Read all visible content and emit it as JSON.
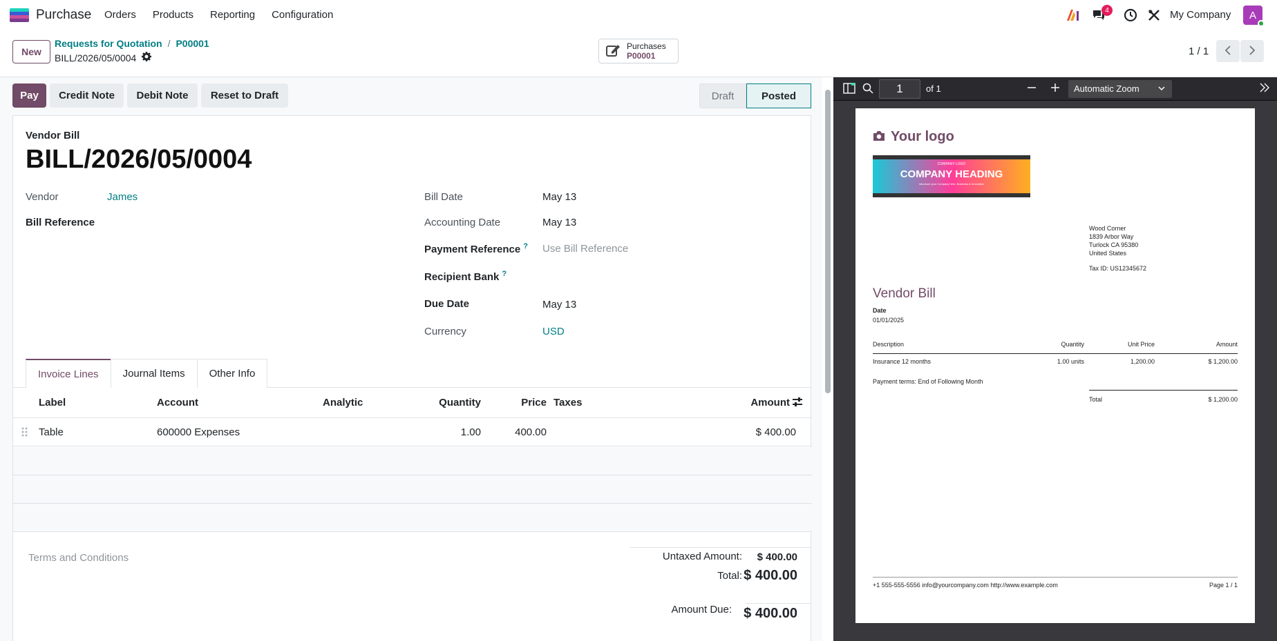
{
  "navbar": {
    "app_name": "Purchase",
    "menu": [
      "Orders",
      "Products",
      "Reporting",
      "Configuration"
    ],
    "chat_badge": "4",
    "company": "My Company",
    "avatar_letter": "A"
  },
  "control_panel": {
    "new_label": "New",
    "breadcrumb": [
      "Requests for Quotation",
      "P00001"
    ],
    "record_name": "BILL/2026/05/0004",
    "smart_button": {
      "label": "Purchases",
      "value": "P00001"
    },
    "pager": "1 / 1"
  },
  "status_bar": {
    "buttons": [
      "Pay",
      "Credit Note",
      "Debit Note",
      "Reset to Draft"
    ],
    "stages": [
      "Draft",
      "Posted"
    ],
    "current_stage": "Posted"
  },
  "form": {
    "doc_type": "Vendor Bill",
    "name": "BILL/2026/05/0004",
    "vendor_label": "Vendor",
    "vendor": "James",
    "bill_ref_label": "Bill Reference",
    "bill_date_label": "Bill Date",
    "bill_date": "May 13",
    "acc_date_label": "Accounting Date",
    "acc_date": "May 13",
    "pay_ref_label": "Payment Reference",
    "pay_ref_placeholder": "Use Bill Reference",
    "recipient_bank_label": "Recipient Bank",
    "due_date_label": "Due Date",
    "due_date": "May 13",
    "currency_label": "Currency",
    "currency": "USD",
    "help_mark": "?"
  },
  "tabs": [
    "Invoice Lines",
    "Journal Items",
    "Other Info"
  ],
  "lines": {
    "headers": [
      "Label",
      "Account",
      "Analytic",
      "Quantity",
      "Price",
      "Taxes",
      "Amount"
    ],
    "rows": [
      {
        "label": "Table",
        "account": "600000 Expenses",
        "analytic": "",
        "quantity": "1.00",
        "price": "400.00",
        "taxes": "",
        "amount": "$ 400.00"
      }
    ]
  },
  "footer": {
    "terms_placeholder": "Terms and Conditions",
    "untaxed_label": "Untaxed Amount:",
    "untaxed": "$ 400.00",
    "total_label": "Total:",
    "total": "$ 400.00",
    "due_label": "Amount Due:",
    "due": "$ 400.00"
  },
  "pdf": {
    "page_input": "1",
    "of_pages": "of 1",
    "zoom": "Automatic Zoom",
    "logo_text": "Your logo",
    "company_logo_small": "COMPANY LOGO",
    "company_heading": "COMPANY HEADING",
    "company_tagline": "Introduce your Company here. Business & Innovation",
    "address": [
      "Wood Corner",
      "1839 Arbor Way",
      "Turlock CA 95380",
      "United States"
    ],
    "tax_id": "Tax ID: US12345672",
    "title": "Vendor Bill",
    "date_label": "Date",
    "date": "01/01/2025",
    "headers": [
      "Description",
      "Quantity",
      "Unit Price",
      "Amount"
    ],
    "row": [
      "Insurance 12 months",
      "1.00 units",
      "1,200.00",
      "$ 1,200.00"
    ],
    "payment_terms": "Payment terms: End of Following Month",
    "total_label": "Total",
    "total": "$ 1,200.00",
    "footer_contact": "+1 555-555-5556 info@yourcompany.com http://www.example.com",
    "footer_page": "Page 1 / 1"
  },
  "colors": {
    "brand": "#714b67",
    "link": "#017e84",
    "badge": "#e31d5b"
  }
}
